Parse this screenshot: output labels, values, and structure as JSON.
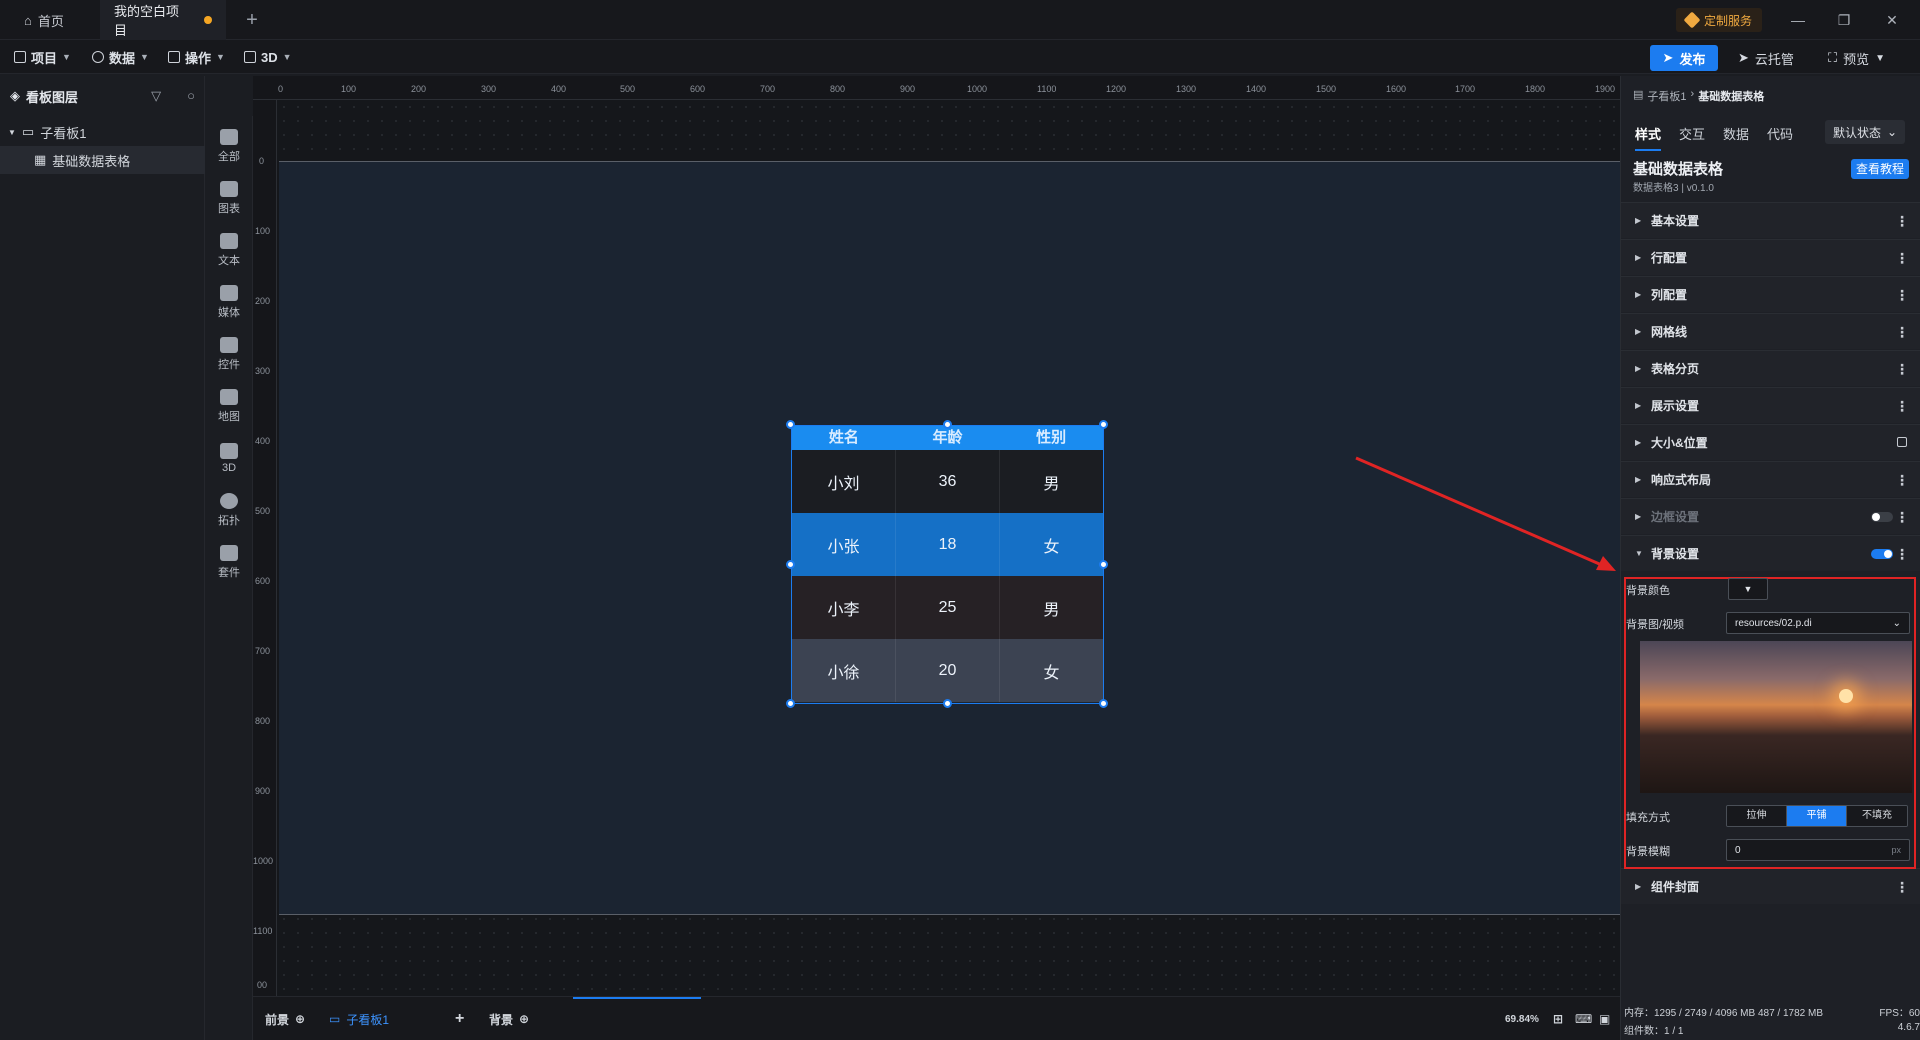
{
  "titlebar": {
    "home_label": "首页",
    "project_label": "我的空白项目",
    "custom_service": "定制服务",
    "add_tab": "+",
    "minimize": "—",
    "restore": "❐",
    "close": "✕"
  },
  "menubar": {
    "items": [
      "项目",
      "数据",
      "操作",
      "3D"
    ],
    "publish": "发布",
    "cloud_host": "云托管",
    "preview": "预览"
  },
  "layers": {
    "title": "看板图层",
    "tree": [
      {
        "label": "子看板1"
      },
      {
        "label": "基础数据表格"
      }
    ]
  },
  "dock": {
    "items": [
      "全部",
      "图表",
      "文本",
      "媒体",
      "控件",
      "地图",
      "3D",
      "拓扑",
      "套件"
    ]
  },
  "ruler": {
    "top": [
      "0",
      "100",
      "200",
      "300",
      "400",
      "500",
      "600",
      "700",
      "800",
      "900",
      "1000",
      "1100",
      "1200",
      "1300",
      "1400",
      "1500",
      "1600",
      "1700",
      "1800",
      "1900"
    ],
    "left": [
      "0",
      "100",
      "200",
      "300",
      "400",
      "500",
      "600",
      "700",
      "800",
      "900",
      "1000",
      "1100",
      "00"
    ]
  },
  "table": {
    "headers": [
      "姓名",
      "年龄",
      "性别"
    ],
    "rows": [
      {
        "name": "小刘",
        "age": "36",
        "gender": "男",
        "bg": "#1b1d22"
      },
      {
        "name": "小张",
        "age": "18",
        "gender": "女",
        "bg": "#1570c6"
      },
      {
        "name": "小李",
        "age": "25",
        "gender": "男",
        "bg": "#262125"
      },
      {
        "name": "小徐",
        "age": "20",
        "gender": "女",
        "bg": "#3c4352"
      }
    ]
  },
  "bottombar": {
    "foreground": "前景",
    "board": "子看板1",
    "add": "+",
    "background": "背景",
    "zoom": "69.84%"
  },
  "props": {
    "crumb_parent": "子看板1",
    "crumb_child": "基础数据表格",
    "tabs": [
      "样式",
      "交互",
      "数据",
      "代码"
    ],
    "state": "默认状态",
    "component_title": "基础数据表格",
    "component_sub": "数据表格3 | v0.1.0",
    "tutorial": "查看教程",
    "sections": [
      "基本设置",
      "行配置",
      "列配置",
      "网格线",
      "表格分页",
      "展示设置",
      "大小&位置",
      "响应式布局",
      "边框设置",
      "背景设置"
    ],
    "cover_section": "组件封面",
    "bg_color_label": "背景颜色",
    "bg_media_label": "背景图/视频",
    "bg_media_value": "resources/02.p.di",
    "fill_label": "填充方式",
    "fill_options": [
      "拉伸",
      "平铺",
      "不填充"
    ],
    "fill_selected": "平铺",
    "blur_label": "背景模糊",
    "blur_value": "0",
    "blur_unit": "px"
  },
  "status": {
    "memory": "内存：1295 / 2749 / 4096 MB  487 / 1782 MB",
    "fps": "FPS：60",
    "components": "组件数：1 / 1",
    "version": "4.6.7"
  },
  "colors": {
    "accent": "#1c7cf0",
    "highlight_box": "#e02424",
    "arrow": "#e02424"
  }
}
